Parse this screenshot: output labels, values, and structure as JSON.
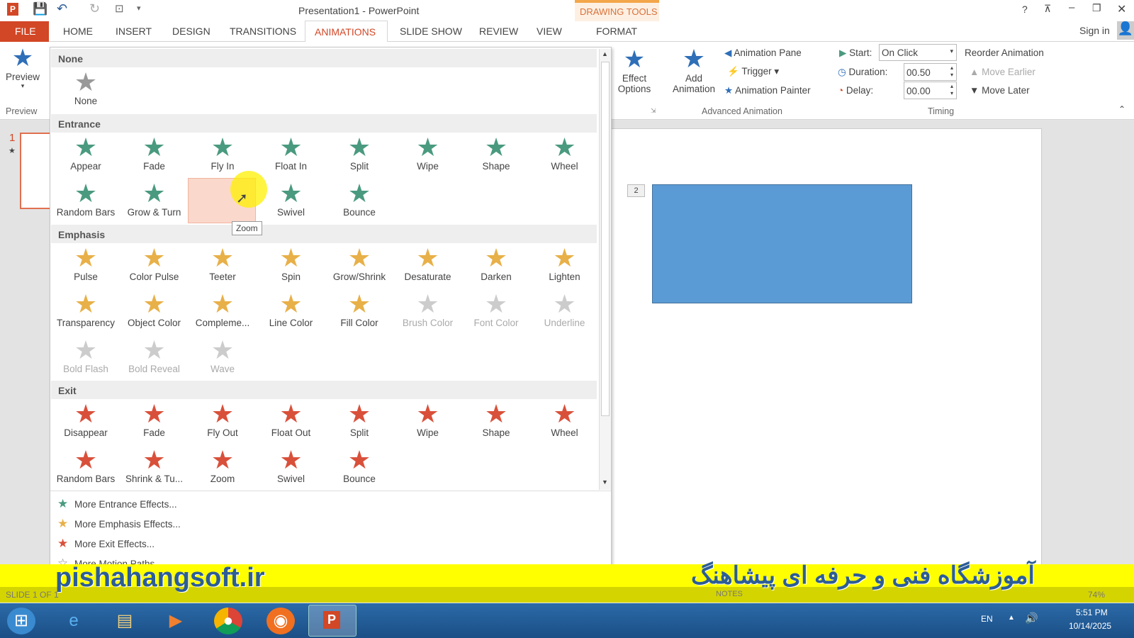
{
  "window": {
    "title": "Presentation1 - PowerPoint",
    "context": "DRAWING TOOLS",
    "sign_in": "Sign in"
  },
  "tabs": [
    "FILE",
    "HOME",
    "INSERT",
    "DESIGN",
    "TRANSITIONS",
    "ANIMATIONS",
    "SLIDE SHOW",
    "REVIEW",
    "VIEW",
    "FORMAT"
  ],
  "ribbon": {
    "preview": "Preview",
    "preview_group": "Preview",
    "effect_options": "Effect Options",
    "add_animation": "Add Animation",
    "animation_pane": "Animation Pane",
    "trigger": "Trigger",
    "animation_painter": "Animation Painter",
    "advanced_group": "Advanced Animation",
    "start_label": "Start:",
    "start_value": "On Click",
    "duration_label": "Duration:",
    "duration_value": "00.50",
    "delay_label": "Delay:",
    "delay_value": "00.00",
    "reorder": "Reorder Animation",
    "move_earlier": "Move Earlier",
    "move_later": "Move Later",
    "timing_group": "Timing"
  },
  "gallery": {
    "none_header": "None",
    "none_items": [
      "None"
    ],
    "entrance_header": "Entrance",
    "entrance": [
      "Appear",
      "Fade",
      "Fly In",
      "Float In",
      "Split",
      "Wipe",
      "Shape",
      "Wheel",
      "Random Bars",
      "Grow & Turn",
      "Zoom",
      "Swivel",
      "Bounce"
    ],
    "emphasis_header": "Emphasis",
    "emphasis": [
      "Pulse",
      "Color Pulse",
      "Teeter",
      "Spin",
      "Grow/Shrink",
      "Desaturate",
      "Darken",
      "Lighten",
      "Transparency",
      "Object Color",
      "Compleme...",
      "Line Color",
      "Fill Color",
      "Brush Color",
      "Font Color",
      "Underline",
      "Bold Flash",
      "Bold Reveal",
      "Wave"
    ],
    "exit_header": "Exit",
    "exit": [
      "Disappear",
      "Fade",
      "Fly Out",
      "Float Out",
      "Split",
      "Wipe",
      "Shape",
      "Wheel",
      "Random Bars",
      "Shrink & Tu...",
      "Zoom",
      "Swivel",
      "Bounce"
    ],
    "tooltip": "Zoom",
    "more": [
      "More Entrance Effects...",
      "More Emphasis Effects...",
      "More Exit Effects...",
      "More Motion Paths..."
    ]
  },
  "slides": {
    "number": "1",
    "shape_tag": "2"
  },
  "status": {
    "slide": "SLIDE 1 OF 1",
    "notes": "NOTES",
    "zoom": "74%"
  },
  "banner": {
    "site": "pishahangsoft.ir",
    "title": "آموزشگاه فنی و حرفه ای پیشاهنگ"
  },
  "taskbar": {
    "lang": "EN",
    "time": "5:51 PM",
    "date": "10/14/2025"
  },
  "colors": {
    "entrance": "#4a9a80",
    "emphasis": "#e8b048",
    "exit": "#d9503a",
    "accent": "#d24726"
  }
}
